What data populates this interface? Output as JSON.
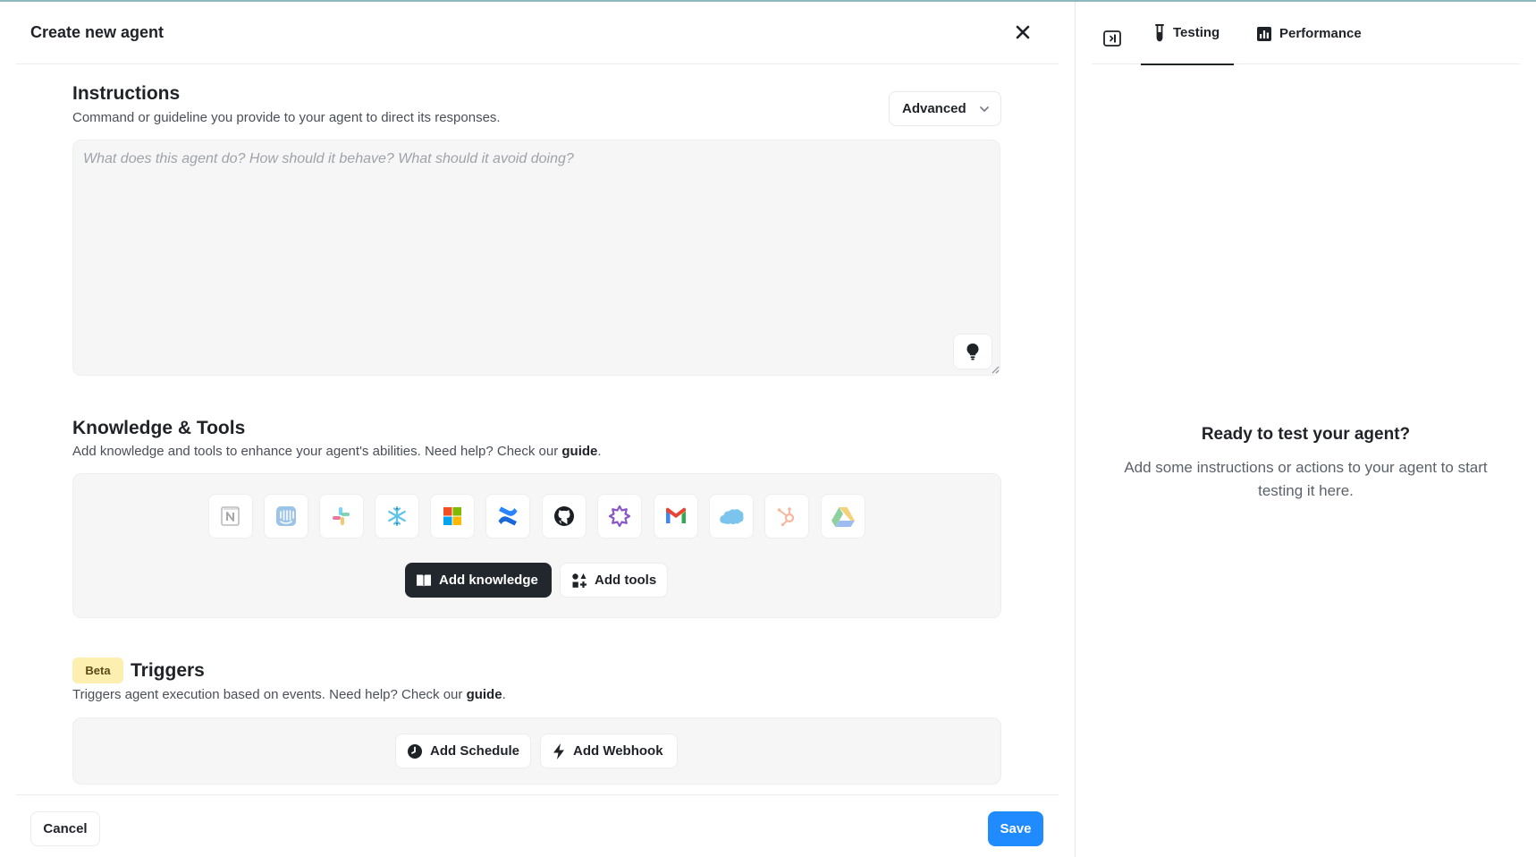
{
  "dialog": {
    "title": "Create new agent",
    "close_icon": "close-icon"
  },
  "instructions": {
    "title": "Instructions",
    "description": "Command or guideline you provide to your agent to direct its responses.",
    "mode_label": "Advanced",
    "placeholder": "What does this agent do? How should it behave? What should it avoid doing?",
    "value": ""
  },
  "knowledge_tools": {
    "title": "Knowledge & Tools",
    "description_prefix": "Add knowledge and tools to enhance your agent's abilities. Need help? Check our ",
    "guide_link": "guide",
    "description_suffix": ".",
    "integrations": [
      {
        "name": "notion-icon"
      },
      {
        "name": "intercom-icon"
      },
      {
        "name": "slack-icon"
      },
      {
        "name": "snowflake-icon"
      },
      {
        "name": "microsoft-icon"
      },
      {
        "name": "confluence-icon"
      },
      {
        "name": "github-icon"
      },
      {
        "name": "zendesk-icon"
      },
      {
        "name": "gmail-icon"
      },
      {
        "name": "salesforce-icon"
      },
      {
        "name": "hubspot-icon"
      },
      {
        "name": "google-drive-icon"
      }
    ],
    "add_knowledge_label": "Add knowledge",
    "add_tools_label": "Add tools"
  },
  "triggers": {
    "badge": "Beta",
    "title": "Triggers",
    "description_prefix": "Triggers agent execution based on events. Need help? Check our ",
    "guide_link": "guide",
    "description_suffix": ".",
    "add_schedule_label": "Add Schedule",
    "add_webhook_label": "Add Webhook"
  },
  "footer": {
    "cancel_label": "Cancel",
    "save_label": "Save"
  },
  "side_panel": {
    "tabs": [
      {
        "label": "Testing",
        "icon": "flask-icon",
        "active": true
      },
      {
        "label": "Performance",
        "icon": "bar-chart-icon",
        "active": false
      }
    ],
    "empty_title": "Ready to test your agent?",
    "empty_description": "Add some instructions or actions to your agent to start testing it here."
  },
  "colors": {
    "primary": "#1f8bff",
    "dark_button": "#22272e",
    "beta_badge": "#fcefb0",
    "panel_bg": "#f6f6f6"
  }
}
